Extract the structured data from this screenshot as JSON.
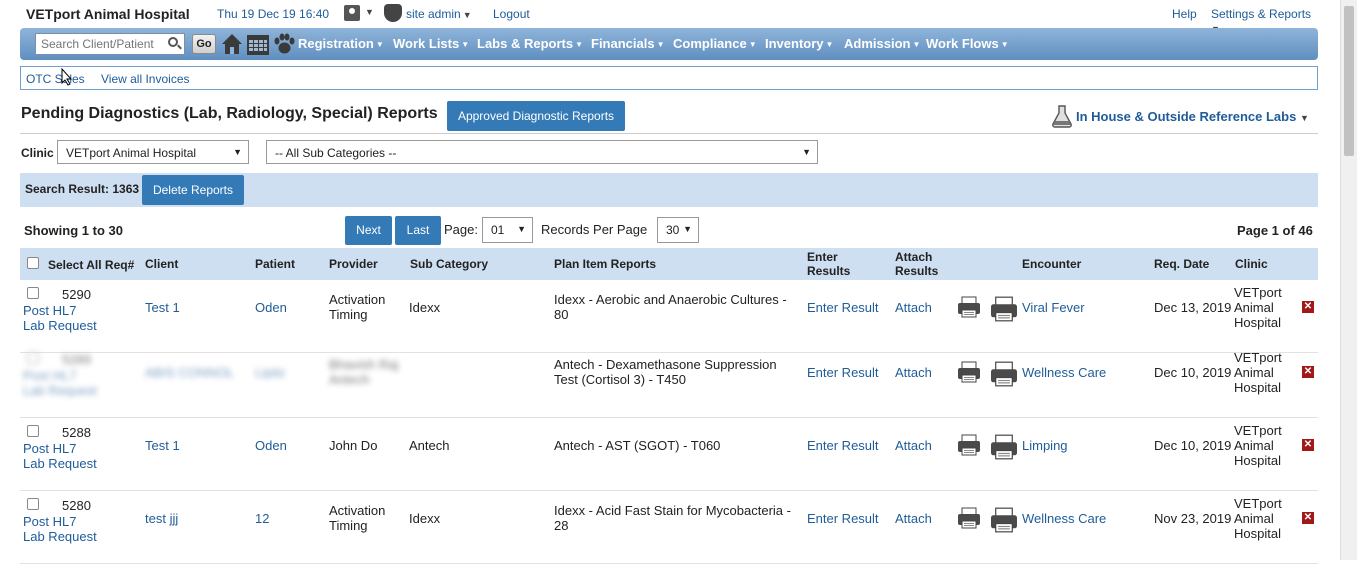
{
  "header": {
    "hospital": "VETport Animal Hospital",
    "datetime": "Thu 19 Dec 19 16:40",
    "user": "site admin",
    "logout": "Logout",
    "help": "Help",
    "settings": "Settings & Reports"
  },
  "nav": {
    "search_placeholder": "Search Client/Patient",
    "go": "Go",
    "items": [
      "Registration",
      "Work Lists",
      "Labs & Reports",
      "Financials",
      "Compliance",
      "Inventory",
      "Admission",
      "Work Flows"
    ]
  },
  "submenu": {
    "otc_sales": "OTC Sales",
    "view_invoices": "View all Invoices"
  },
  "page": {
    "title": "Pending Diagnostics (Lab, Radiology, Special) Reports",
    "approved_button": "Approved Diagnostic Reports",
    "labs_link": "In House & Outside Reference Labs"
  },
  "filters": {
    "clinic_label": "Clinic",
    "clinic_value": "VETport Animal Hospital",
    "subcategory_value": "-- All Sub Categories --"
  },
  "results": {
    "label": "Search Result: 1363",
    "delete_button": "Delete Reports"
  },
  "pagination": {
    "showing": "Showing 1 to 30",
    "next": "Next",
    "last": "Last",
    "page_label": "Page:",
    "page_value": "01",
    "records_label": "Records Per Page",
    "records_value": "30",
    "page_of": "Page 1 of 46"
  },
  "table": {
    "headers": {
      "select_all": "Select All Req#",
      "client": "Client",
      "patient": "Patient",
      "provider": "Provider",
      "sub_category": "Sub Category",
      "plan_item": "Plan Item Reports",
      "enter_results_1": "Enter",
      "enter_results_2": "Results",
      "attach_results_1": "Attach",
      "attach_results_2": "Results",
      "encounter": "Encounter",
      "req_date": "Req. Date",
      "clinic": "Clinic"
    },
    "rows": [
      {
        "req": "5290",
        "hl7_1": "Post HL7",
        "hl7_2": "Lab Request",
        "client": "Test 1",
        "patient": "Oden",
        "provider_1": "Activation",
        "provider_2": "Timing",
        "sub_category": "Idexx",
        "plan_1": "Idexx - Aerobic and Anaerobic Cultures -",
        "plan_2": "80",
        "enter": "Enter Result",
        "attach": "Attach",
        "encounter": "Viral Fever",
        "date": "Dec 13, 2019",
        "clinic_1": "VETport",
        "clinic_2": "Animal",
        "clinic_3": "Hospital"
      },
      {
        "req": "5289",
        "hl7_1": "Post HL7",
        "hl7_2": "Lab Request",
        "client": "ABIS CONNOL",
        "patient": "Lipitz",
        "provider_1": "Bhavish Raj",
        "provider_2": "Antech",
        "sub_category": "",
        "plan_1": "Antech - Dexamethasone Suppression",
        "plan_2": "Test (Cortisol 3) - T450",
        "enter": "Enter Result",
        "attach": "Attach",
        "encounter": "Wellness Care",
        "date": "Dec 10, 2019",
        "clinic_1": "VETport",
        "clinic_2": "Animal",
        "clinic_3": "Hospital"
      },
      {
        "req": "5288",
        "hl7_1": "Post HL7",
        "hl7_2": "Lab Request",
        "client": "Test 1",
        "patient": "Oden",
        "provider_1": "John Do",
        "provider_2": "",
        "sub_category": "Antech",
        "plan_1": "Antech - AST (SGOT) - T060",
        "plan_2": "",
        "enter": "Enter Result",
        "attach": "Attach",
        "encounter": "Limping",
        "date": "Dec 10, 2019",
        "clinic_1": "VETport",
        "clinic_2": "Animal",
        "clinic_3": "Hospital"
      },
      {
        "req": "5280",
        "hl7_1": "Post HL7",
        "hl7_2": "Lab Request",
        "client": "test jjj",
        "patient": "12",
        "provider_1": "Activation",
        "provider_2": "Timing",
        "sub_category": "Idexx",
        "plan_1": "Idexx - Acid Fast Stain for Mycobacteria -",
        "plan_2": "28",
        "enter": "Enter Result",
        "attach": "Attach",
        "encounter": "Wellness Care",
        "date": "Nov 23, 2019",
        "clinic_1": "VETport",
        "clinic_2": "Animal",
        "clinic_3": "Hospital"
      }
    ]
  },
  "colors": {
    "accent": "#337ab7",
    "nav_bar": "#6f9ccb",
    "header_band": "#cddff0",
    "link": "#1f5c99",
    "delete_icon": "#a01818"
  }
}
